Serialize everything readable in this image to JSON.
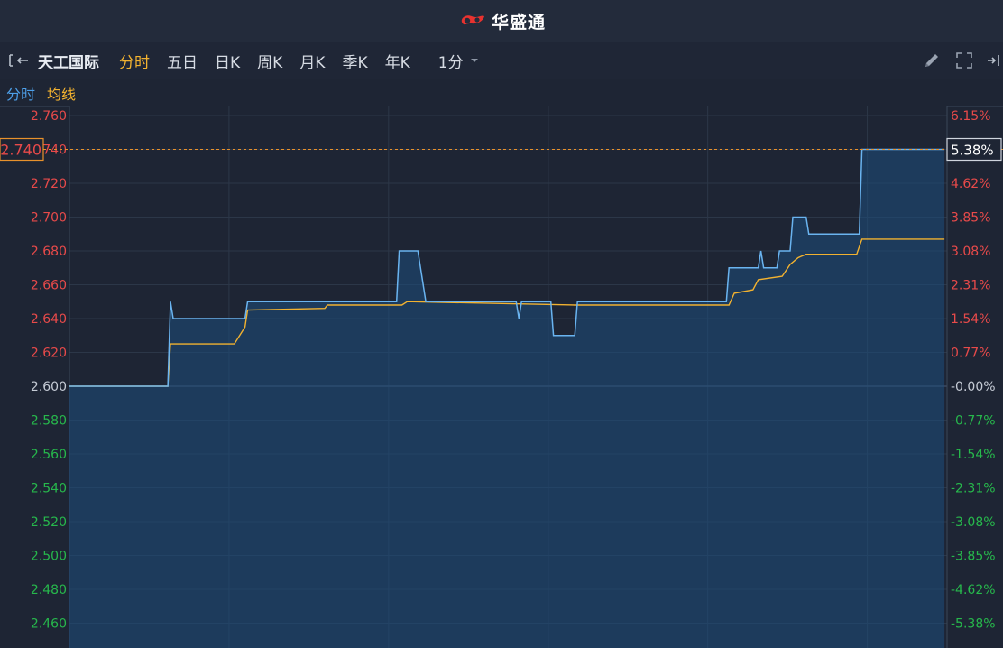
{
  "header": {
    "brand": "华盛通"
  },
  "toolbar": {
    "stock_name": "天工国际",
    "tabs": [
      "分时",
      "五日",
      "日K",
      "周K",
      "月K",
      "季K",
      "年K"
    ],
    "active_tab": 0,
    "period": "1分"
  },
  "legend": {
    "items": [
      {
        "label": "分时",
        "color": "#4d9fe8"
      },
      {
        "label": "均线",
        "color": "#f2b230"
      }
    ]
  },
  "colors": {
    "up": "#e84a4a",
    "down": "#27b84c",
    "neutral": "#c6ccd6",
    "price_line": "#6ab4f0",
    "avg_line": "#f2b230",
    "grid": "#2c3748",
    "background": "#1e2534",
    "crosshair": "#e8912c"
  },
  "chart_data": {
    "type": "line",
    "base_price": 2.6,
    "ylim": [
      2.44,
      2.76
    ],
    "y_ticks": [
      "2.760",
      "2.740",
      "2.720",
      "2.700",
      "2.680",
      "2.660",
      "2.640",
      "2.620",
      "2.600",
      "2.580",
      "2.560",
      "2.540",
      "2.520",
      "2.500",
      "2.480",
      "2.460"
    ],
    "y_ticks_right": [
      "6.15%",
      "5.38%",
      "4.62%",
      "3.85%",
      "3.08%",
      "2.31%",
      "1.54%",
      "0.77%",
      "-0.00%",
      "-0.77%",
      "-1.54%",
      "-2.31%",
      "-3.08%",
      "-3.85%",
      "-4.62%",
      "-5.38%"
    ],
    "y_tick_values": [
      2.76,
      2.74,
      2.72,
      2.7,
      2.68,
      2.66,
      2.64,
      2.62,
      2.6,
      2.58,
      2.56,
      2.54,
      2.52,
      2.5,
      2.48,
      2.46
    ],
    "crosshair": {
      "price": "2.740",
      "change": "5.38%",
      "value": 2.74
    },
    "time_range": [
      0,
      330
    ],
    "series": [
      {
        "key": "price",
        "points": [
          [
            0,
            2.6
          ],
          [
            37,
            2.6
          ],
          [
            38,
            2.65
          ],
          [
            39,
            2.64
          ],
          [
            66,
            2.64
          ],
          [
            67,
            2.65
          ],
          [
            123,
            2.65
          ],
          [
            124,
            2.68
          ],
          [
            131,
            2.68
          ],
          [
            134,
            2.65
          ],
          [
            168,
            2.65
          ],
          [
            169,
            2.64
          ],
          [
            170,
            2.65
          ],
          [
            181,
            2.65
          ],
          [
            182,
            2.63
          ],
          [
            190,
            2.63
          ],
          [
            191,
            2.65
          ],
          [
            247,
            2.65
          ],
          [
            248,
            2.67
          ],
          [
            259,
            2.67
          ],
          [
            260,
            2.68
          ],
          [
            261,
            2.67
          ],
          [
            266,
            2.67
          ],
          [
            267,
            2.68
          ],
          [
            271,
            2.68
          ],
          [
            272,
            2.7
          ],
          [
            277,
            2.7
          ],
          [
            278,
            2.69
          ],
          [
            297,
            2.69
          ],
          [
            298,
            2.74
          ],
          [
            329,
            2.74
          ]
        ]
      },
      {
        "key": "avg",
        "points": [
          [
            0,
            2.6
          ],
          [
            37,
            2.6
          ],
          [
            38,
            2.625
          ],
          [
            62,
            2.625
          ],
          [
            66,
            2.635
          ],
          [
            67,
            2.645
          ],
          [
            96,
            2.646
          ],
          [
            97,
            2.648
          ],
          [
            125,
            2.648
          ],
          [
            127,
            2.65
          ],
          [
            190,
            2.648
          ],
          [
            248,
            2.648
          ],
          [
            250,
            2.655
          ],
          [
            257,
            2.657
          ],
          [
            259,
            2.663
          ],
          [
            268,
            2.665
          ],
          [
            271,
            2.672
          ],
          [
            274,
            2.676
          ],
          [
            277,
            2.678
          ],
          [
            296,
            2.678
          ],
          [
            298,
            2.687
          ],
          [
            329,
            2.687
          ]
        ]
      }
    ]
  }
}
